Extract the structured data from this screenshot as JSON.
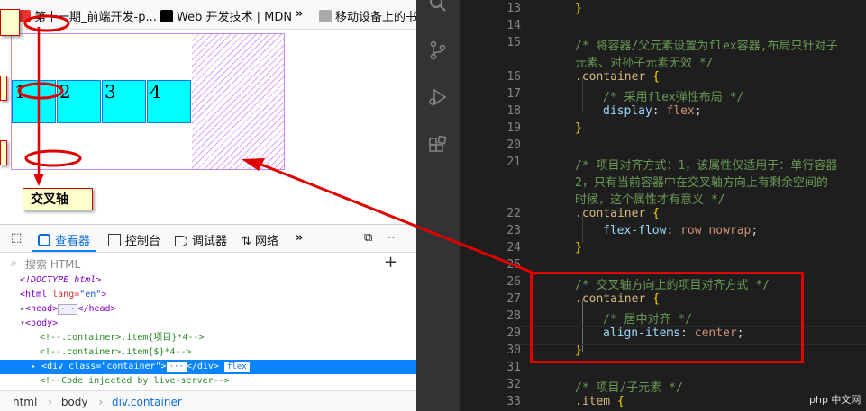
{
  "browser": {
    "bookmarks": [
      {
        "label": "第十一期_前端开发-p...",
        "icon": "bookmark-icon-red"
      },
      {
        "label": "Web 开发技术 | MDN",
        "icon": "mdn-icon"
      },
      {
        "label": "»",
        "icon": "more-bookmarks"
      },
      {
        "label": "移动设备上的书签",
        "icon": "folder-icon"
      }
    ]
  },
  "demo": {
    "items": [
      "1",
      "2",
      "3",
      "4"
    ],
    "annotation_label": "交叉轴"
  },
  "devtools": {
    "tabs": [
      {
        "label": "查看器",
        "icon": "inspector-icon"
      },
      {
        "label": "控制台",
        "icon": "console-icon"
      },
      {
        "label": "调试器",
        "icon": "debugger-icon"
      },
      {
        "label": "网络",
        "icon": "network-icon"
      }
    ],
    "search_placeholder": "搜索 HTML",
    "tree": [
      {
        "text": "<!DOCTYPE html>"
      },
      {
        "tag": "<html",
        "attr": " lang=",
        "val": "\"en\"",
        "close": ">"
      },
      {
        "text": "<head>",
        "badge": "···",
        "tail": "</head>"
      },
      {
        "text": "<body>"
      },
      {
        "comment": "<!--.container>.item{项目}*4-->"
      },
      {
        "comment": "<!--.container>.item{$}*4-->"
      },
      {
        "tag": "<div",
        "attr": " class=",
        "val": "\"container\"",
        "close": ">",
        "badge": "···",
        "tail": "</div>",
        "flex": "flex"
      },
      {
        "comment": "<!--Code injected by live-server-->"
      }
    ],
    "breadcrumbs": [
      "html",
      "body",
      "div.container"
    ]
  },
  "editor": {
    "lines": [
      {
        "n": "13",
        "parts": [
          [
            "c-br",
            "}"
          ]
        ],
        "indent": 0
      },
      {
        "n": "14",
        "parts": [],
        "indent": 0
      },
      {
        "n": "15",
        "parts": [
          [
            "c-cm",
            "/* 将容器/父元素设置为flex容器,布局只针对子"
          ]
        ],
        "indent": 0
      },
      {
        "n": "",
        "parts": [
          [
            "c-cm",
            "元素、对孙子元素无效 */"
          ]
        ],
        "indent": 0
      },
      {
        "n": "16",
        "parts": [
          [
            "c-sel",
            ".container"
          ],
          [
            "",
            " "
          ],
          [
            "c-br",
            "{"
          ]
        ],
        "indent": 0
      },
      {
        "n": "17",
        "parts": [
          [
            "c-cm",
            "/* 采用flex弹性布局 */"
          ]
        ],
        "indent": 1
      },
      {
        "n": "18",
        "parts": [
          [
            "c-prop",
            "display"
          ],
          [
            "",
            ": "
          ],
          [
            "c-val",
            "flex"
          ],
          [
            "",
            ";"
          ]
        ],
        "indent": 1
      },
      {
        "n": "19",
        "parts": [
          [
            "c-br",
            "}"
          ]
        ],
        "indent": 0
      },
      {
        "n": "20",
        "parts": [],
        "indent": 0
      },
      {
        "n": "21",
        "parts": [
          [
            "c-cm",
            "/* 项目对齐方式：1，该属性仅适用于：单行容器"
          ]
        ],
        "indent": 0
      },
      {
        "n": "",
        "parts": [
          [
            "c-cm",
            "2，只有当前容器中在交叉轴方向上有剩余空间的"
          ]
        ],
        "indent": 0
      },
      {
        "n": "",
        "parts": [
          [
            "c-cm",
            "时候，这个属性才有意义 */"
          ]
        ],
        "indent": 0
      },
      {
        "n": "22",
        "parts": [
          [
            "c-sel",
            ".container"
          ],
          [
            "",
            " "
          ],
          [
            "c-br",
            "{"
          ]
        ],
        "indent": 0
      },
      {
        "n": "23",
        "parts": [
          [
            "c-prop",
            "flex-flow"
          ],
          [
            "",
            ": "
          ],
          [
            "c-val",
            "row nowrap"
          ],
          [
            "",
            ";"
          ]
        ],
        "indent": 1
      },
      {
        "n": "24",
        "parts": [
          [
            "c-br",
            "}"
          ]
        ],
        "indent": 0
      },
      {
        "n": "25",
        "parts": [],
        "indent": 0
      },
      {
        "n": "26",
        "parts": [
          [
            "c-cm",
            "/* 交叉轴方向上的项目对齐方式 */"
          ]
        ],
        "indent": 0
      },
      {
        "n": "27",
        "parts": [
          [
            "c-sel",
            ".container"
          ],
          [
            "",
            " "
          ],
          [
            "c-br",
            "{"
          ]
        ],
        "indent": 0
      },
      {
        "n": "28",
        "parts": [
          [
            "c-cm",
            "/* 居中对齐 */"
          ]
        ],
        "indent": 1
      },
      {
        "n": "29",
        "parts": [
          [
            "c-prop",
            "align-items"
          ],
          [
            "",
            ": "
          ],
          [
            "c-val",
            "center"
          ],
          [
            "",
            ";"
          ]
        ],
        "indent": 1
      },
      {
        "n": "30",
        "parts": [
          [
            "c-br",
            "}"
          ]
        ],
        "indent": 0
      },
      {
        "n": "31",
        "parts": [],
        "indent": 0
      },
      {
        "n": "32",
        "parts": [
          [
            "c-cm",
            "/* 项目/子元素 */"
          ]
        ],
        "indent": 0
      },
      {
        "n": "33",
        "parts": [
          [
            "c-sel",
            ".item"
          ],
          [
            "",
            " "
          ],
          [
            "c-br",
            "{"
          ]
        ],
        "indent": 0
      }
    ]
  },
  "watermark": "php 中文网",
  "colors": {
    "annotation_red": "#e00000",
    "item_fill": "#00ffff",
    "container_outline": "#c58af9"
  }
}
